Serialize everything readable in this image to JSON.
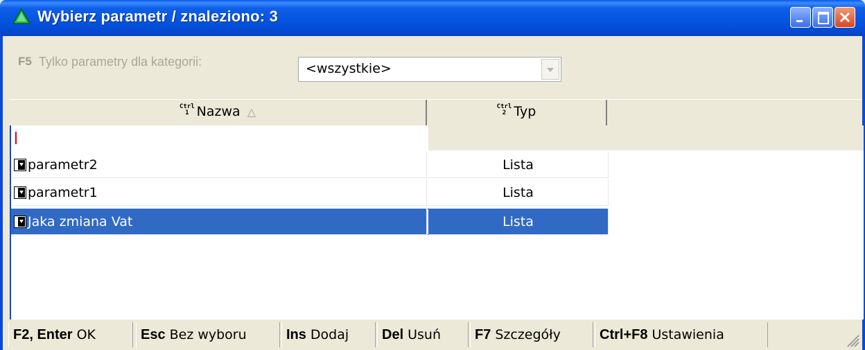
{
  "window": {
    "title": "Wybierz parametr / znaleziono: 3",
    "app_icon": "green-triangle-icon"
  },
  "filter": {
    "key": "F5",
    "label": "Tylko parametry dla kategorii:",
    "selected": "<wszystkie>"
  },
  "grid": {
    "columns": [
      {
        "ctrl_top": "Ctrl",
        "ctrl_num": "1",
        "label": "Nazwa",
        "sort": "ascending"
      },
      {
        "ctrl_top": "Ctrl",
        "ctrl_num": "2",
        "label": "Typ"
      }
    ],
    "rows": [
      {
        "name": "parametr2",
        "typ": "Lista",
        "selected": false
      },
      {
        "name": "parametr1",
        "typ": "Lista",
        "selected": false
      },
      {
        "name": "Jaka zmiana Vat",
        "typ": "Lista",
        "selected": true
      }
    ]
  },
  "statusbar": [
    {
      "key": "F2, Enter",
      "label": "OK"
    },
    {
      "key": "Esc",
      "label": "Bez wyboru"
    },
    {
      "key": "Ins",
      "label": "Dodaj"
    },
    {
      "key": "Del",
      "label": "Usuń"
    },
    {
      "key": "F7",
      "label": "Szczegóły"
    },
    {
      "key": "Ctrl+F8",
      "label": "Ustawienia"
    }
  ],
  "colors": {
    "titlebar": "#0553e0",
    "selection": "#316ac5",
    "chrome": "#ece9d8"
  }
}
